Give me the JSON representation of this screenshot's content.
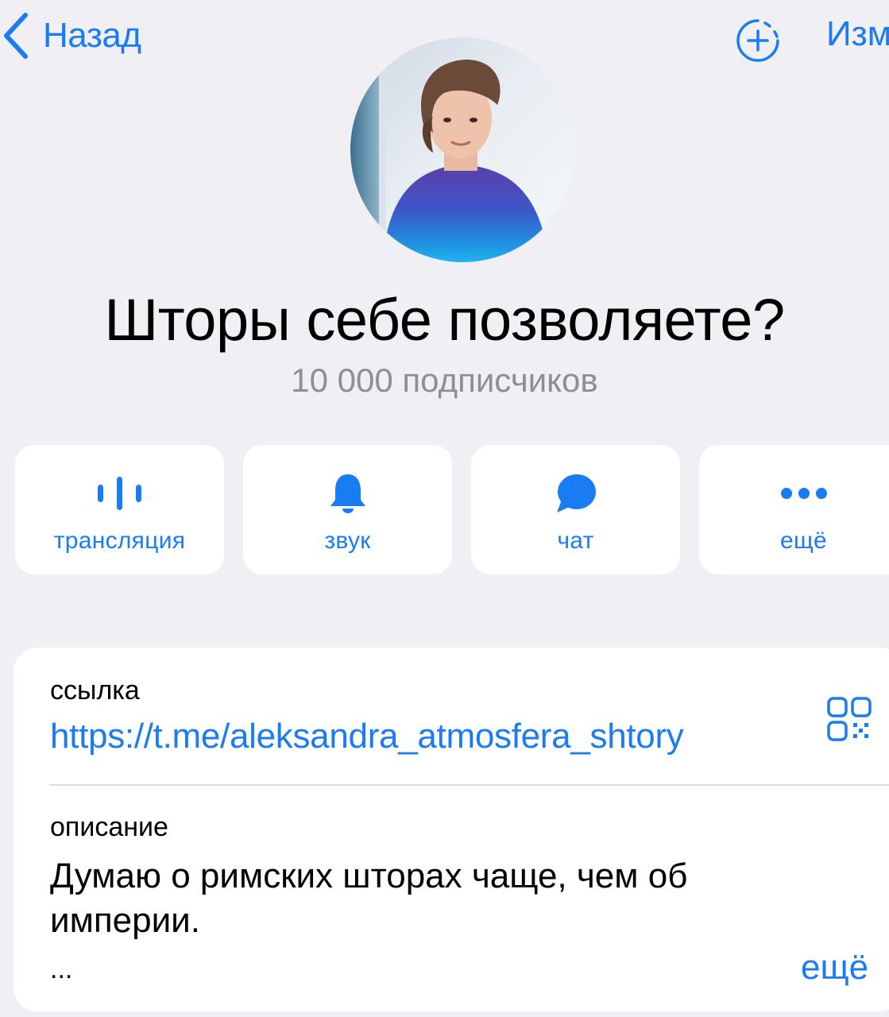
{
  "nav": {
    "back_label": "Назад",
    "edit_label": "Изм"
  },
  "channel": {
    "title": "Шторы себе позволяете?",
    "subscribers": "10 000 подписчиков"
  },
  "actions": [
    {
      "label": "трансляция",
      "icon": "live-stream-icon"
    },
    {
      "label": "звук",
      "icon": "bell-icon"
    },
    {
      "label": "чат",
      "icon": "chat-bubble-icon"
    },
    {
      "label": "ещё",
      "icon": "more-dots-icon"
    }
  ],
  "info": {
    "link_label": "ссылка",
    "link_value": "https://t.me/aleksandra_atmosfera_shtory",
    "description_label": "описание",
    "description_text": "Думаю о римских шторах чаще, чем об империи.",
    "ellipsis": "...",
    "more_label": "ещё"
  },
  "colors": {
    "accent": "#1a7cf3",
    "background": "#efeff4",
    "secondary_text": "#8e8e93"
  }
}
